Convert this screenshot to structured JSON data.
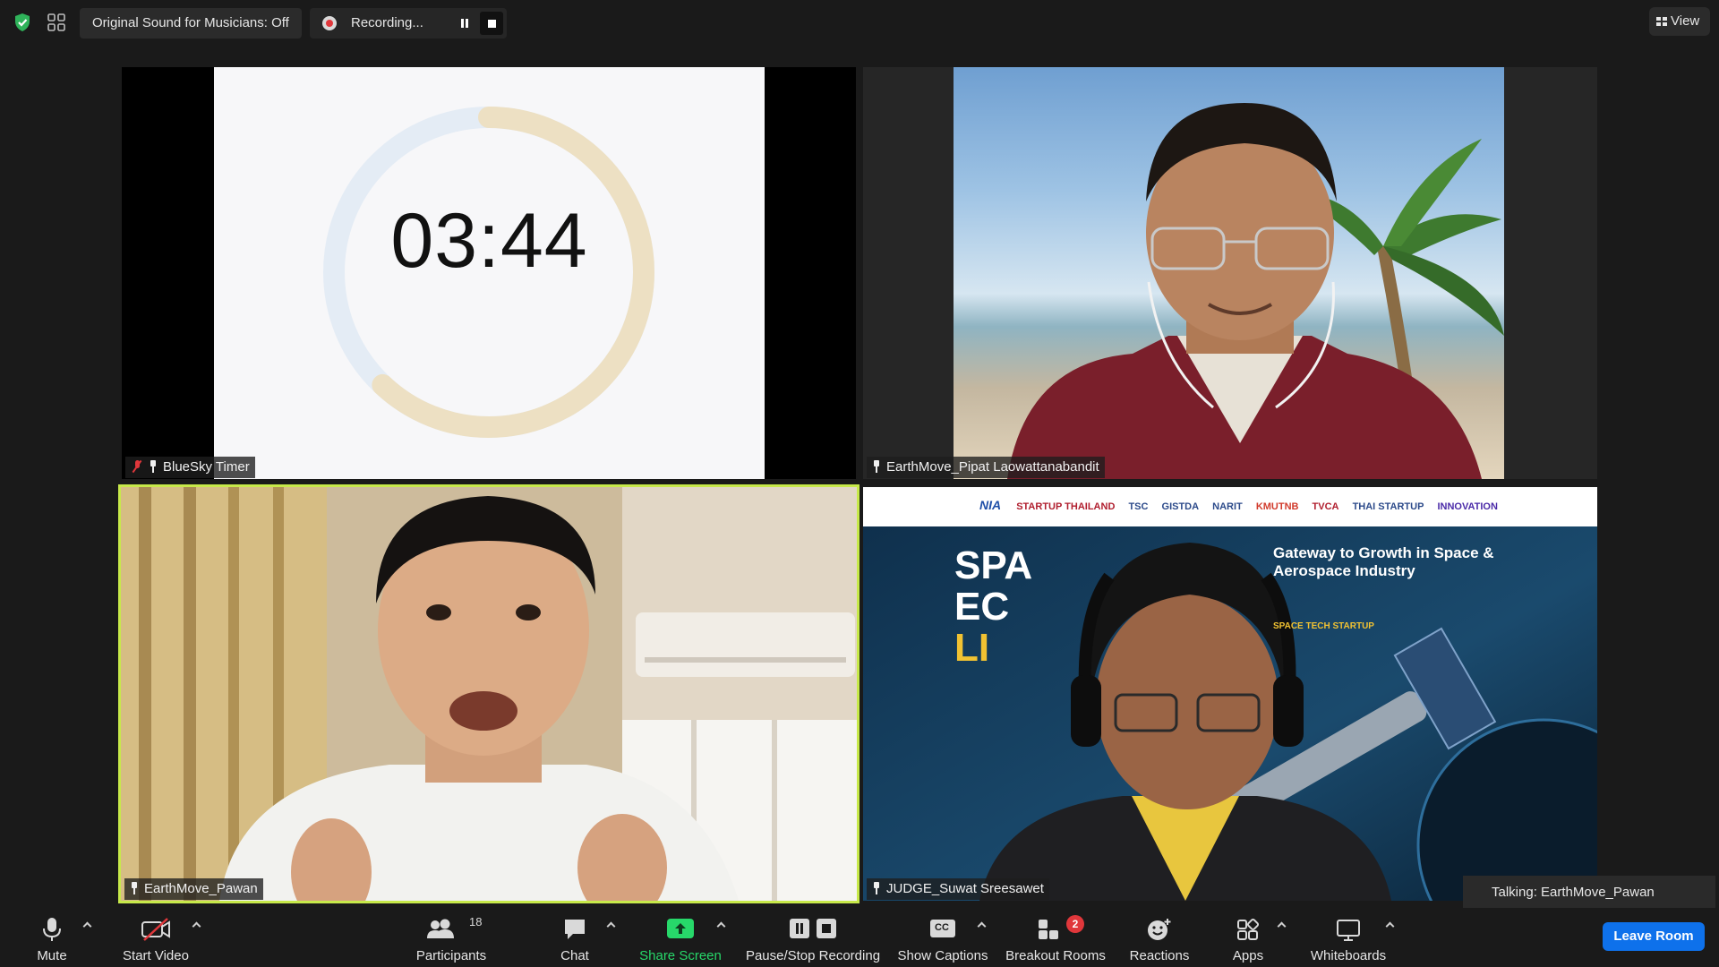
{
  "topbar": {
    "original_sound": "Original Sound for Musicians: Off",
    "recording_label": "Recording...",
    "view_label": "View"
  },
  "tiles": [
    {
      "name": "BlueSky Timer",
      "muted": true,
      "pinned": true,
      "timer": "03:44",
      "timer_progress": 0.62
    },
    {
      "name": "EarthMove_Pipat Laowattanabandit",
      "pinned": true
    },
    {
      "name": "EarthMove_Pawan",
      "pinned": true,
      "active_speaker": true
    },
    {
      "name": "JUDGE_Suwat Sreesawet",
      "pinned": true,
      "banner": {
        "sponsors": [
          "NIA",
          "STARTUP THAILAND",
          "TSC",
          "GISTDA",
          "NARIT",
          "KMUTNB",
          "TVCA",
          "THAI STARTUP",
          "INNOVATION"
        ],
        "headline": "Gateway to Growth in Space & Aerospace Industry",
        "big_letters_1": "SPA",
        "big_letters_2": "EC",
        "big_letters_3": "LI",
        "tagline": "SPACE TECH STARTUP"
      }
    }
  ],
  "talking": "Talking: EarthMove_Pawan",
  "toolbar": {
    "mute": "Mute",
    "start_video": "Start Video",
    "participants": "Participants",
    "participants_count": "18",
    "chat": "Chat",
    "share_screen": "Share Screen",
    "pause_stop_recording": "Pause/Stop Recording",
    "show_captions": "Show Captions",
    "captions_icon_text": "CC",
    "breakout_rooms": "Breakout Rooms",
    "breakout_badge": "2",
    "reactions": "Reactions",
    "apps": "Apps",
    "whiteboards": "Whiteboards",
    "leave_room": "Leave Room"
  },
  "colors": {
    "active_speaker_border": "#c7e94a",
    "share_green": "#27d86a",
    "leave_blue": "#0e71eb",
    "timer_remaining": "#ede0c3",
    "timer_elapsed": "#e4ecf5"
  }
}
